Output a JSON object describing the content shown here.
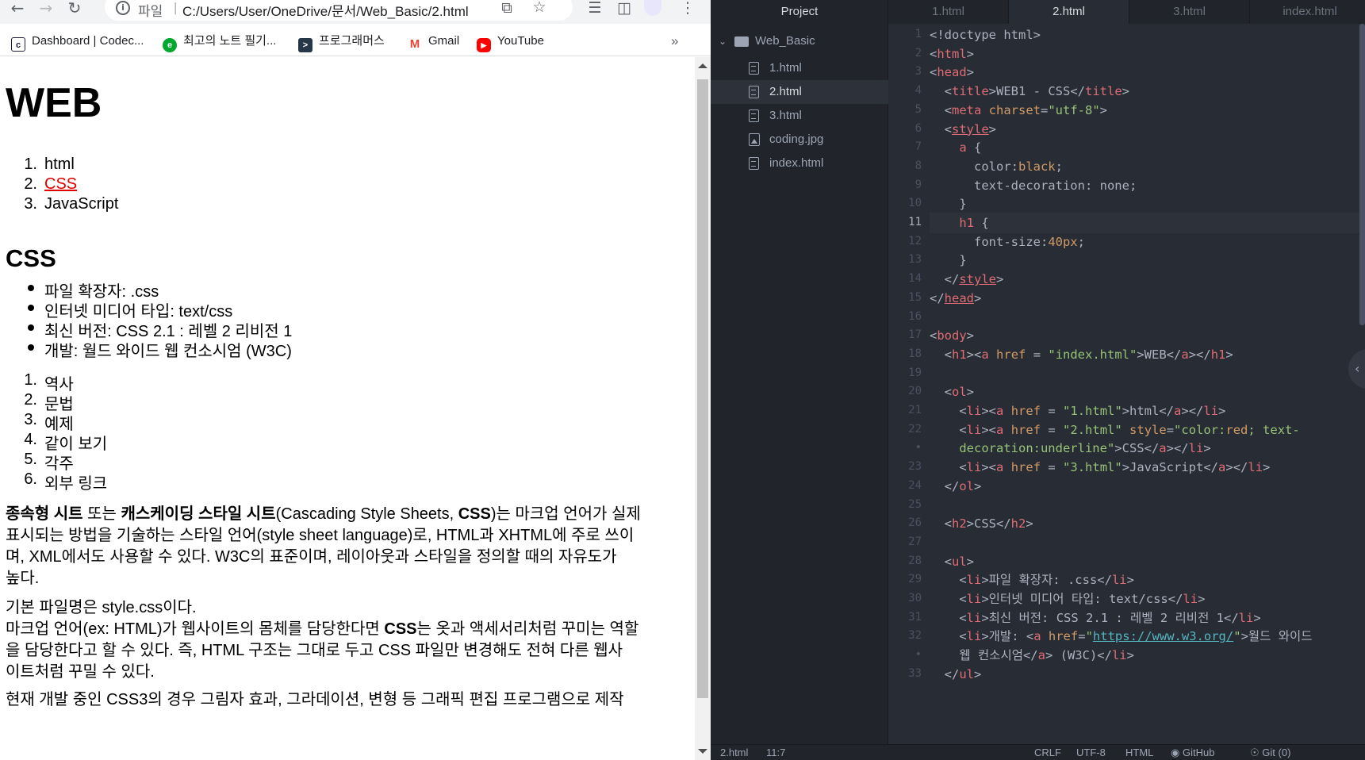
{
  "browser": {
    "omnibox": {
      "scheme": "파일",
      "url": "C:/Users/User/OneDrive/문서/Web_Basic/2.html"
    },
    "bookmarks": [
      {
        "label": "Dashboard | Codec...",
        "icon": "codecademy-icon"
      },
      {
        "label": "최고의 노트 필기...",
        "icon": "evernote-icon"
      },
      {
        "label": "프로그래머스",
        "icon": "programmers-icon"
      },
      {
        "label": "Gmail",
        "icon": "gmail-icon"
      },
      {
        "label": "YouTube",
        "icon": "youtube-icon"
      }
    ],
    "bookmarks_more": "»",
    "page": {
      "h1": "WEB",
      "nav": [
        {
          "num": "1.",
          "label": "html"
        },
        {
          "num": "2.",
          "label": "CSS"
        },
        {
          "num": "3.",
          "label": "JavaScript"
        }
      ],
      "h2": "CSS",
      "facts": [
        "파일 확장자: .css",
        "인터넷 미디어 타입: text/css",
        "최신 버전: CSS 2.1 : 레벨 2 리비전 1",
        "개발: 월드 와이드 웹 컨소시엄 (W3C)"
      ],
      "toc": [
        {
          "num": "1.",
          "label": "역사"
        },
        {
          "num": "2.",
          "label": "문법"
        },
        {
          "num": "3.",
          "label": "예제"
        },
        {
          "num": "4.",
          "label": "같이 보기"
        },
        {
          "num": "5.",
          "label": "각주"
        },
        {
          "num": "6.",
          "label": "외부 링크"
        }
      ],
      "p1_lines": [
        [
          "종속형 시트",
          " 또는 ",
          "캐스케이딩 스타일 시트",
          "(Cascading Style Sheets, ",
          "CSS",
          ")는 마크업 언어가 실제"
        ],
        "표시되는 방법을 기술하는 스타일 언어(style sheet language)로, HTML과 XHTML에 주로 쓰이",
        "며, XML에서도 사용할 수 있다. W3C의 표준이며, 레이아웃과 스타일을 정의할 때의 자유도가",
        "높다."
      ],
      "p2_line1": "기본 파일명은 style.css이다.",
      "p2_line2": [
        "마크업 언어(ex: HTML)가 웹사이트의 몸체를 담당한다면 ",
        "CSS",
        "는 옷과 액세서리처럼 꾸미는 역할"
      ],
      "p2_line3": "을 담당한다고 할 수 있다. 즉, HTML 구조는 그대로 두고 CSS 파일만 변경해도 전혀 다른 웹사",
      "p2_line4": "이트처럼 꾸밀 수 있다.",
      "p3_line1": "현재 개발 중인 CSS3의 경우 그림자 효과, 그라데이션, 변형 등 그래픽 편집 프로그램으로 제작"
    }
  },
  "editor": {
    "tree": {
      "header": "Project",
      "folder": "Web_Basic",
      "files": [
        "1.html",
        "2.html",
        "3.html",
        "coding.jpg",
        "index.html"
      ],
      "selected": "2.html"
    },
    "tabs": [
      "1.html",
      "2.html",
      "3.html",
      "index.html"
    ],
    "active_tab": "2.html",
    "line_numbers": [
      "1",
      "2",
      "3",
      "4",
      "5",
      "6",
      "7",
      "8",
      "9",
      "10",
      "11",
      "12",
      "13",
      "14",
      "15",
      "16",
      "17",
      "18",
      "19",
      "20",
      "21",
      "22",
      "•",
      "23",
      "24",
      "25",
      "26",
      "27",
      "28",
      "29",
      "30",
      "31",
      "32",
      "•",
      "33"
    ],
    "current_line": "11",
    "code": [
      [
        [
          "pn",
          "<!doctype html>"
        ]
      ],
      [
        [
          "pn",
          "<"
        ],
        [
          "tg",
          "html"
        ],
        [
          "pn",
          ">"
        ]
      ],
      [
        [
          "pn",
          "<"
        ],
        [
          "tg",
          "head"
        ],
        [
          "pn",
          ">"
        ]
      ],
      [
        [
          "pn",
          "  <"
        ],
        [
          "tg",
          "title"
        ],
        [
          "pn",
          ">WEB1 - CSS</"
        ],
        [
          "tg",
          "title"
        ],
        [
          "pn",
          ">"
        ]
      ],
      [
        [
          "pn",
          "  <"
        ],
        [
          "tg",
          "meta"
        ],
        [
          "pn",
          " "
        ],
        [
          "at",
          "charset"
        ],
        [
          "pn",
          "="
        ],
        [
          "st",
          "\"utf-8\""
        ],
        [
          "pn",
          ">"
        ]
      ],
      [
        [
          "pn",
          "  <"
        ],
        [
          "tgu",
          "style"
        ],
        [
          "pn",
          ">"
        ]
      ],
      [
        [
          "pn",
          "    "
        ],
        [
          "tg",
          "a"
        ],
        [
          "pn",
          " {"
        ]
      ],
      [
        [
          "pn",
          "      color:"
        ],
        [
          "at",
          "black"
        ],
        [
          "pn",
          ";"
        ]
      ],
      [
        [
          "pn",
          "      text-decoration: none;"
        ]
      ],
      [
        [
          "pn",
          "    }"
        ]
      ],
      [
        [
          "pn",
          "    "
        ],
        [
          "tg",
          "h1"
        ],
        [
          "pn",
          " {"
        ]
      ],
      [
        [
          "pn",
          "      font-size:"
        ],
        [
          "at",
          "40px"
        ],
        [
          "pn",
          ";"
        ]
      ],
      [
        [
          "pn",
          "    }"
        ]
      ],
      [
        [
          "pn",
          "  </"
        ],
        [
          "tgu",
          "style"
        ],
        [
          "pn",
          ">"
        ]
      ],
      [
        [
          "pn",
          "</"
        ],
        [
          "tgu",
          "head"
        ],
        [
          "pn",
          ">"
        ]
      ],
      [
        [
          "pn",
          ""
        ]
      ],
      [
        [
          "pn",
          "<"
        ],
        [
          "tg",
          "body"
        ],
        [
          "pn",
          ">"
        ]
      ],
      [
        [
          "pn",
          "  <"
        ],
        [
          "tg",
          "h1"
        ],
        [
          "pn",
          "><"
        ],
        [
          "tg",
          "a"
        ],
        [
          "pn",
          " "
        ],
        [
          "at",
          "href"
        ],
        [
          "pn",
          " = "
        ],
        [
          "st",
          "\"index.html\""
        ],
        [
          "pn",
          ">WEB</"
        ],
        [
          "tg",
          "a"
        ],
        [
          "pn",
          "></"
        ],
        [
          "tg",
          "h1"
        ],
        [
          "pn",
          ">"
        ]
      ],
      [
        [
          "pn",
          ""
        ]
      ],
      [
        [
          "pn",
          "  <"
        ],
        [
          "tg",
          "ol"
        ],
        [
          "pn",
          ">"
        ]
      ],
      [
        [
          "pn",
          "    <"
        ],
        [
          "tg",
          "li"
        ],
        [
          "pn",
          "><"
        ],
        [
          "tg",
          "a"
        ],
        [
          "pn",
          " "
        ],
        [
          "at",
          "href"
        ],
        [
          "pn",
          " = "
        ],
        [
          "st",
          "\"1.html\""
        ],
        [
          "pn",
          ">html</"
        ],
        [
          "tg",
          "a"
        ],
        [
          "pn",
          "></"
        ],
        [
          "tg",
          "li"
        ],
        [
          "pn",
          ">"
        ]
      ],
      [
        [
          "pn",
          "    <"
        ],
        [
          "tg",
          "li"
        ],
        [
          "pn",
          "><"
        ],
        [
          "tg",
          "a"
        ],
        [
          "pn",
          " "
        ],
        [
          "at",
          "href"
        ],
        [
          "pn",
          " = "
        ],
        [
          "st",
          "\"2.html\""
        ],
        [
          "pn",
          " "
        ],
        [
          "at",
          "style"
        ],
        [
          "pn",
          "="
        ],
        [
          "st",
          "\"color:"
        ],
        [
          "at",
          "red"
        ],
        [
          "st",
          "; text-"
        ]
      ],
      [
        [
          "st",
          "    decoration:underline\""
        ],
        [
          "pn",
          ">CSS</"
        ],
        [
          "tg",
          "a"
        ],
        [
          "pn",
          "></"
        ],
        [
          "tg",
          "li"
        ],
        [
          "pn",
          ">"
        ]
      ],
      [
        [
          "pn",
          "    <"
        ],
        [
          "tg",
          "li"
        ],
        [
          "pn",
          "><"
        ],
        [
          "tg",
          "a"
        ],
        [
          "pn",
          " "
        ],
        [
          "at",
          "href"
        ],
        [
          "pn",
          " = "
        ],
        [
          "st",
          "\"3.html\""
        ],
        [
          "pn",
          ">JavaScript</"
        ],
        [
          "tg",
          "a"
        ],
        [
          "pn",
          "></"
        ],
        [
          "tg",
          "li"
        ],
        [
          "pn",
          ">"
        ]
      ],
      [
        [
          "pn",
          "  </"
        ],
        [
          "tg",
          "ol"
        ],
        [
          "pn",
          ">"
        ]
      ],
      [
        [
          "pn",
          ""
        ]
      ],
      [
        [
          "pn",
          "  <"
        ],
        [
          "tg",
          "h2"
        ],
        [
          "pn",
          ">CSS</"
        ],
        [
          "tg",
          "h2"
        ],
        [
          "pn",
          ">"
        ]
      ],
      [
        [
          "pn",
          ""
        ]
      ],
      [
        [
          "pn",
          "  <"
        ],
        [
          "tg",
          "ul"
        ],
        [
          "pn",
          ">"
        ]
      ],
      [
        [
          "pn",
          "    <"
        ],
        [
          "tg",
          "li"
        ],
        [
          "pn",
          ">파일 확장자: .css</"
        ],
        [
          "tg",
          "li"
        ],
        [
          "pn",
          ">"
        ]
      ],
      [
        [
          "pn",
          "    <"
        ],
        [
          "tg",
          "li"
        ],
        [
          "pn",
          ">인터넷 미디어 타입: text/css</"
        ],
        [
          "tg",
          "li"
        ],
        [
          "pn",
          ">"
        ]
      ],
      [
        [
          "pn",
          "    <"
        ],
        [
          "tg",
          "li"
        ],
        [
          "pn",
          ">최신 버전: CSS 2.1 : 레벨 2 리비전 1</"
        ],
        [
          "tg",
          "li"
        ],
        [
          "pn",
          ">"
        ]
      ],
      [
        [
          "pn",
          "    <"
        ],
        [
          "tg",
          "li"
        ],
        [
          "pn",
          ">개발: <"
        ],
        [
          "tg",
          "a"
        ],
        [
          "pn",
          " "
        ],
        [
          "at",
          "href"
        ],
        [
          "pn",
          "="
        ],
        [
          "st",
          "\""
        ],
        [
          "un",
          "https://www.w3.org/"
        ],
        [
          "st",
          "\""
        ],
        [
          "pn",
          ">월드 와이드"
        ]
      ],
      [
        [
          "pn",
          "    웹 컨소시엄</"
        ],
        [
          "tg",
          "a"
        ],
        [
          "pn",
          "> (W3C)</"
        ],
        [
          "tg",
          "li"
        ],
        [
          "pn",
          ">"
        ]
      ],
      [
        [
          "pn",
          "  </"
        ],
        [
          "tg",
          "ul"
        ],
        [
          "pn",
          ">"
        ]
      ]
    ],
    "status": {
      "file": "2.html",
      "cursor": "11:7",
      "eol": "CRLF",
      "encoding": "UTF-8",
      "grammar": "HTML",
      "github": "GitHub",
      "git": "Git (0)"
    }
  }
}
